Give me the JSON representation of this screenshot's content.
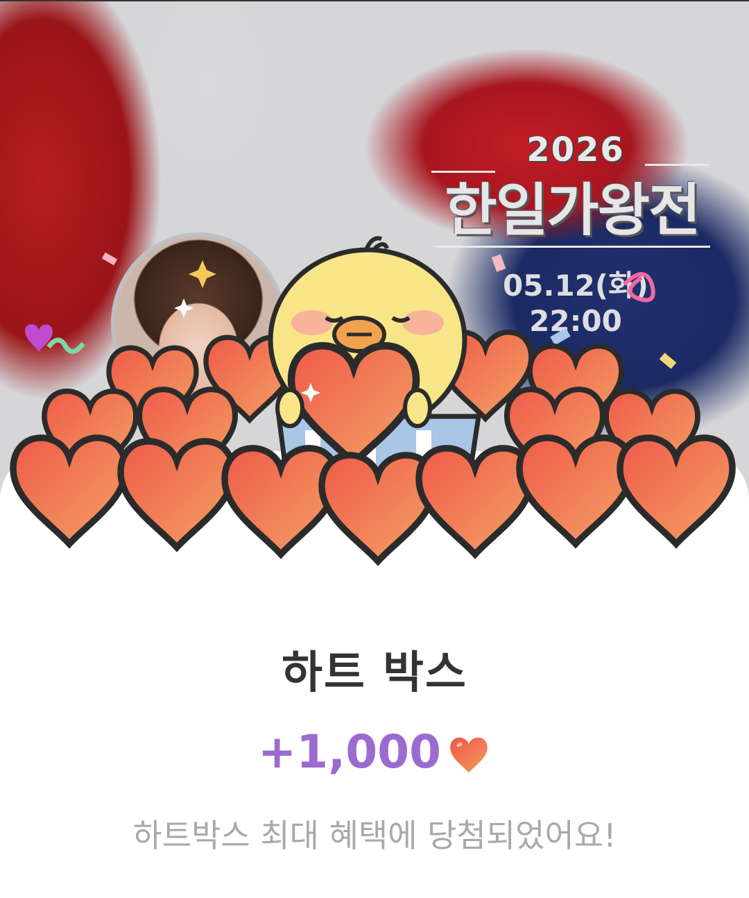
{
  "banner": {
    "year": "2026",
    "title": "한일가왕전",
    "date": "05.12(화)",
    "time": "22:00"
  },
  "reward": {
    "title": "하트 박스",
    "amount": "+1,000",
    "currency_icon": "heart-icon",
    "message": "하트박스 최대 혜택에 당첨되었어요!"
  },
  "colors": {
    "amount": "#9b6bd0",
    "heart": "#f0604a",
    "title_text": "#333333",
    "message_text": "#a9a9ab"
  }
}
